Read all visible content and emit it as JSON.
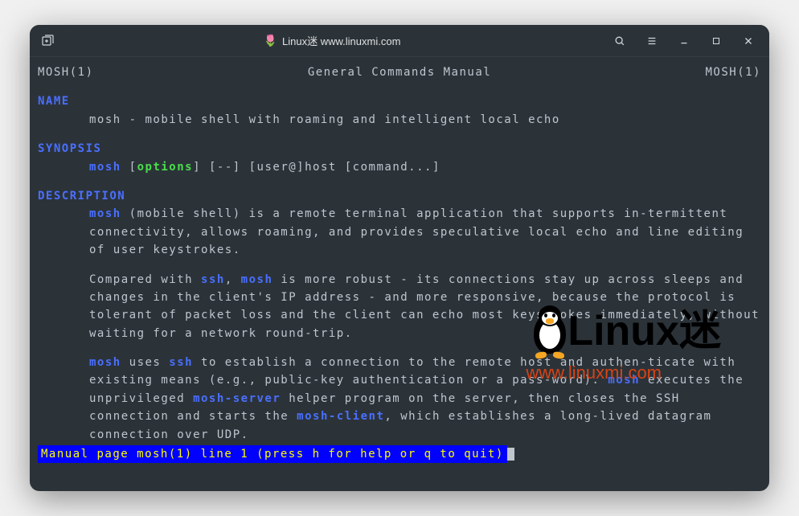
{
  "titlebar": {
    "tulip": "🌷",
    "title": "Linux迷 www.linuxmi.com"
  },
  "man": {
    "header_left": "MOSH(1)",
    "header_center": "General Commands Manual",
    "header_right": "MOSH(1)",
    "name_section": "NAME",
    "name_line": "mosh - mobile shell with roaming and intelligent local echo",
    "synopsis_section": "SYNOPSIS",
    "synopsis": {
      "cmd": "mosh",
      "options": "options",
      "rest": "] [--] [user@]host [command...]"
    },
    "description_section": "DESCRIPTION",
    "para1": {
      "cmd": "mosh",
      "text": "  (mobile shell) is a remote terminal application that supports in‐termittent connectivity, allows roaming, and provides speculative local echo and line editing of user keystrokes."
    },
    "para2": {
      "prefix": "Compared with ",
      "ssh": "ssh",
      "mid1": ", ",
      "mosh": "mosh",
      "text": " is more robust - its connections stay up across sleeps and changes in the client's IP address -  and  more  responsive, because the protocol is tolerant of packet loss and the client can echo most keystrokes immediately, without waiting for a network round-trip."
    },
    "para3": {
      "cmd": "mosh",
      "mid1": " uses ",
      "ssh": "ssh",
      "text1": " to establish a connection to the remote host and  authen‐ticate  with existing means (e.g., public-key authentication or a pass‐word). ",
      "cmd2": "mosh",
      "text2": " executes the unprivileged ",
      "server": "mosh-server",
      "text3": " helper program on the server,  then  closes  the  SSH  connection and starts the ",
      "client": "mosh-client",
      "text4": ", which establishes a long-lived datagram connection over UDP."
    },
    "status": " Manual page mosh(1) line 1 (press h for help or q to quit)"
  },
  "watermark": {
    "title": "Linux",
    "suffix": "迷",
    "url": "www.linuxmi.com"
  }
}
